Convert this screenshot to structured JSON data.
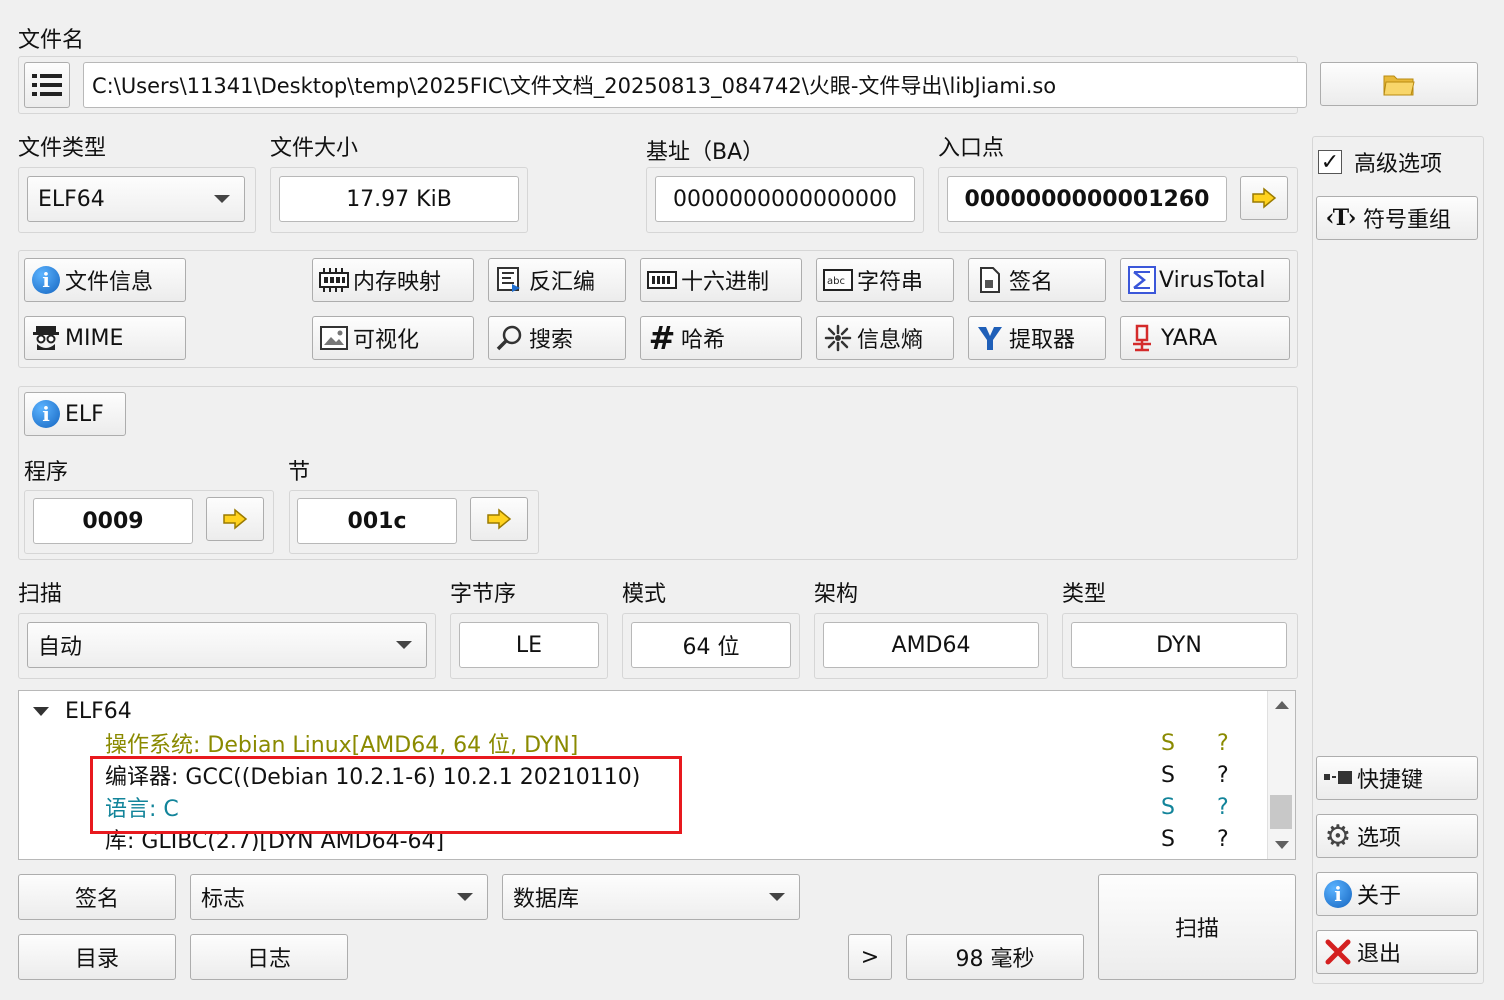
{
  "file": {
    "label": "文件名",
    "path": "C:\\Users\\11341\\Desktop\\temp\\2025FIC\\文件文档_20250813_084742\\火眼-文件导出\\libJiami.so"
  },
  "info": {
    "file_type_label": "文件类型",
    "file_type_value": "ELF64",
    "file_size_label": "文件大小",
    "file_size_value": "17.97 KiB",
    "base_label": "基址（BA）",
    "base_value": "0000000000000000",
    "entry_label": "入口点",
    "entry_value": "0000000000001260"
  },
  "tools": {
    "file_info": "文件信息",
    "memory_map": "内存映射",
    "disasm": "反汇编",
    "hex": "十六进制",
    "strings": "字符串",
    "signature": "签名",
    "virustotal": "VirusTotal",
    "mime": "MIME",
    "visualize": "可视化",
    "search": "搜索",
    "hash": "哈希",
    "entropy": "信息熵",
    "extractor": "提取器",
    "yara": "YARA"
  },
  "elf": {
    "button": "ELF",
    "program_label": "程序",
    "program_value": "0009",
    "section_label": "节",
    "section_value": "001c"
  },
  "scan": {
    "label": "扫描",
    "mode_value": "自动",
    "endian_label": "字节序",
    "endian_value": "LE",
    "mode_label": "模式",
    "bits_value": "64 位",
    "arch_label": "架构",
    "arch_value": "AMD64",
    "type_label": "类型",
    "type_value": "DYN"
  },
  "results": {
    "root": "ELF64",
    "rows": [
      {
        "text": "操作系统: Debian Linux[AMD64, 64 位, DYN]",
        "s": "S",
        "q": "?"
      },
      {
        "text": "编译器: GCC((Debian 10.2.1-6) 10.2.1 20210110)",
        "s": "S",
        "q": "?"
      },
      {
        "text": "语言: C",
        "s": "S",
        "q": "?"
      },
      {
        "text": "库: GLIBC(2.7)[DYN AMD64-64]",
        "s": "S",
        "q": "?"
      }
    ]
  },
  "bottom": {
    "signature": "签名",
    "flags": "标志",
    "database": "数据库",
    "directory": "目录",
    "log": "日志",
    "more": ">",
    "elapsed": "98 毫秒",
    "scan": "扫描"
  },
  "side": {
    "advanced": "高级选项",
    "symbol_regroup": "符号重组",
    "shortcuts": "快捷键",
    "options": "选项",
    "about": "关于",
    "exit": "退出"
  },
  "colors": {
    "os_row": "#8a8a00",
    "lang_row": "#12849a",
    "highlight": "#e8191e"
  }
}
